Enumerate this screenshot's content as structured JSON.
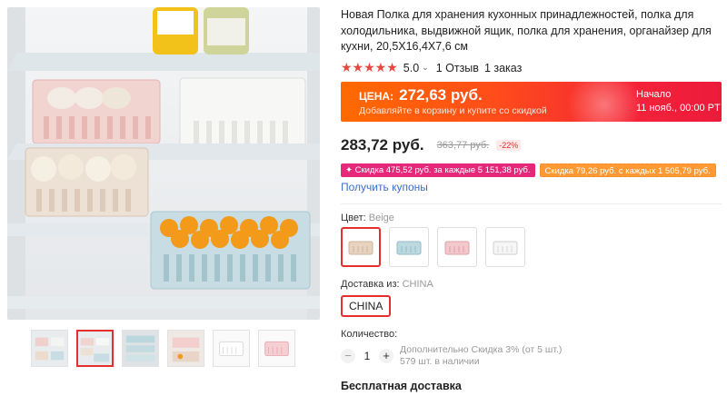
{
  "product": {
    "title": "Новая Полка для хранения кухонных принадлежностей, полка для холодильника, выдвижной ящик, полка для хранения, органайзер для кухни, 20,5X16,4X7,6 см",
    "rating": {
      "stars": "★★★★★",
      "score": "5.0",
      "reviews": "1 Отзыв",
      "orders": "1 заказ"
    }
  },
  "promo": {
    "label": "ЦЕНА:",
    "price": "272,63 руб.",
    "subtitle": "Добавляйте в корзину и купите со скидкой",
    "start_label": "Начало",
    "start_date": "11 нояб., 00:00 PT"
  },
  "price": {
    "current": "283,72 руб.",
    "old": "363,77 руб.",
    "discount": "-22%"
  },
  "coupons": [
    "✦ Скидка 475,52 руб. за каждые 5 151,38 руб.",
    "Скидка 79,26 руб. с каждых 1 505,79 руб."
  ],
  "get_coupons": "Получить купоны",
  "color": {
    "label": "Цвет:",
    "value": "Beige"
  },
  "shipping": {
    "label": "Доставка из:",
    "value": "CHINA",
    "option": "CHINA"
  },
  "quantity": {
    "label": "Количество:",
    "value": "1",
    "minus": "−",
    "plus": "+",
    "extra_discount": "Дополнительно Скидка 3% (от 5 шт.)",
    "stock": "579 шт. в наличии"
  },
  "free_shipping": "Бесплатная доставка",
  "colors": {
    "accent": "#e62e2e",
    "beige": "#e8d3c0",
    "blue": "#bcd9e0",
    "pink": "#f3c8cc",
    "white": "#f6f6f6"
  }
}
